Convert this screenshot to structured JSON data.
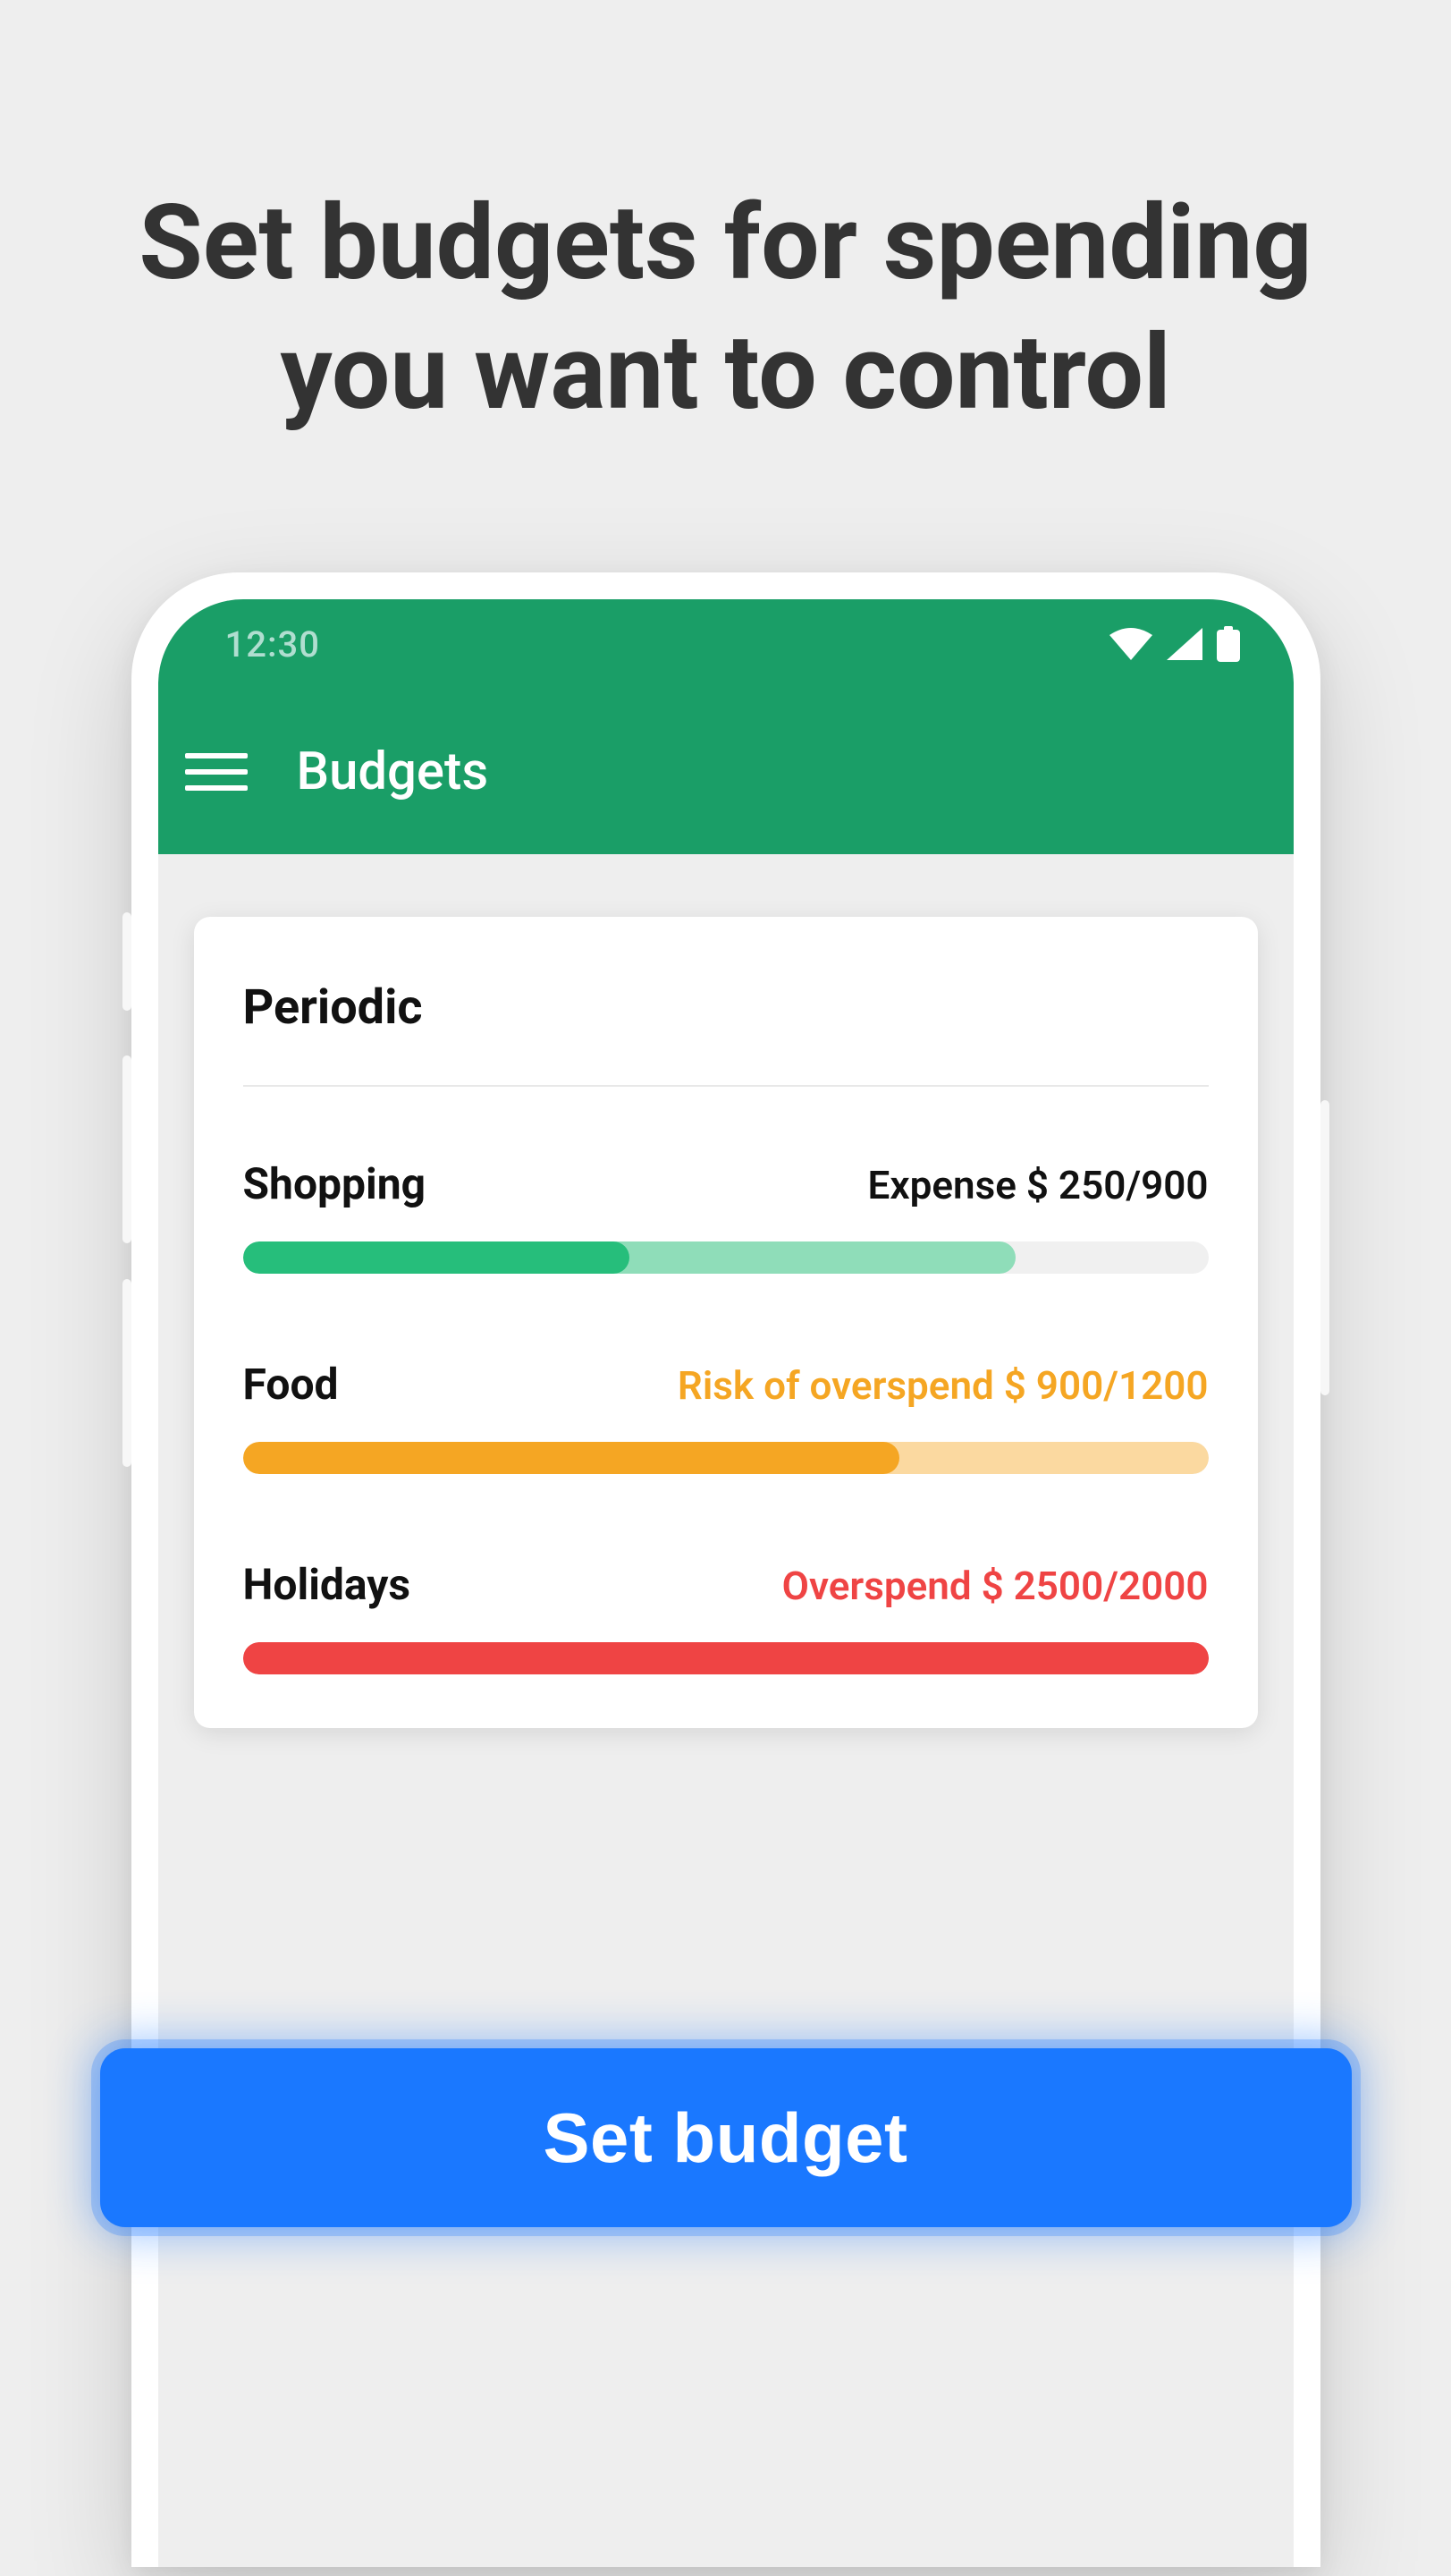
{
  "promo_title": "Set budgets for spending you want to control",
  "status_bar": {
    "time": "12:30"
  },
  "app_bar": {
    "title": "Budgets"
  },
  "card": {
    "section_title": "Periodic",
    "items": [
      {
        "name": "Shopping",
        "status_label": "Expense",
        "spent": 250,
        "limit": 900,
        "status_text": "Expense $ 250/900",
        "status_class": "status-default",
        "fill_color": "#26be7b",
        "proj_color": "#8fddb9",
        "fill_pct": 40,
        "proj_pct": 80
      },
      {
        "name": "Food",
        "status_label": "Risk of overspend",
        "spent": 900,
        "limit": 1200,
        "status_text": "Risk of overspend $ 900/1200",
        "status_class": "status-warn",
        "fill_color": "#f5a623",
        "proj_color": "#fbd9a0",
        "fill_pct": 68,
        "proj_pct": 100
      },
      {
        "name": "Holidays",
        "status_label": "Overspend",
        "spent": 2500,
        "limit": 2000,
        "status_text": "Overspend $ 2500/2000",
        "status_class": "status-over",
        "fill_color": "#ef4444",
        "proj_color": "#ef4444",
        "fill_pct": 100,
        "proj_pct": 100
      }
    ]
  },
  "cta": {
    "label": "Set budget"
  }
}
